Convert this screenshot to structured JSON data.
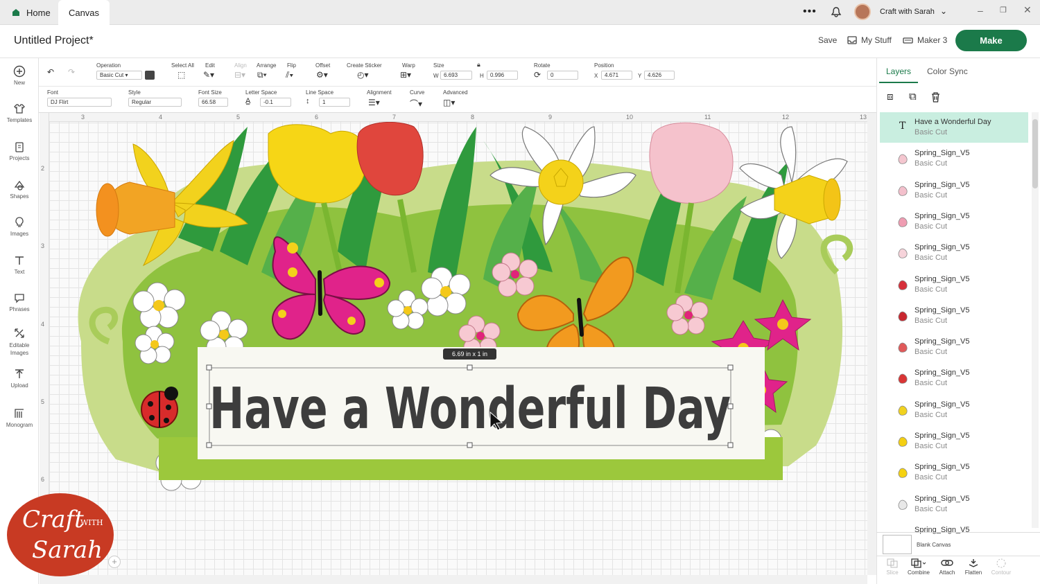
{
  "top_tabs": {
    "home": "Home",
    "canvas": "Canvas"
  },
  "account": {
    "name": "Craft with Sarah"
  },
  "project": {
    "title": "Untitled Project*",
    "save": "Save",
    "my_stuff": "My Stuff",
    "machine": "Maker 3",
    "make": "Make"
  },
  "left_nav": [
    {
      "label": "New",
      "icon": "plus-circle-icon"
    },
    {
      "label": "Templates",
      "icon": "shirt-icon"
    },
    {
      "label": "Projects",
      "icon": "clipboard-icon"
    },
    {
      "label": "Shapes",
      "icon": "shapes-icon"
    },
    {
      "label": "Images",
      "icon": "bulb-icon"
    },
    {
      "label": "Text",
      "icon": "text-icon"
    },
    {
      "label": "Phrases",
      "icon": "speech-icon"
    },
    {
      "label": "Editable Images",
      "icon": "edit-image-icon"
    },
    {
      "label": "Upload",
      "icon": "upload-icon"
    },
    {
      "label": "Monogram",
      "icon": "monogram-icon"
    }
  ],
  "toolbar1": {
    "operation_label": "Operation",
    "operation_value": "Basic Cut",
    "select_all": "Select All",
    "edit": "Edit",
    "align": "Align",
    "arrange": "Arrange",
    "flip": "Flip",
    "offset": "Offset",
    "create_sticker": "Create Sticker",
    "warp": "Warp",
    "size_label": "Size",
    "w_label": "W",
    "w_value": "6.693",
    "h_label": "H",
    "h_value": "0.996",
    "rotate_label": "Rotate",
    "rotate_value": "0",
    "position_label": "Position",
    "x_label": "X",
    "x_value": "4.671",
    "y_label": "Y",
    "y_value": "4.626"
  },
  "toolbar2": {
    "font_label": "Font",
    "font_value": "DJ Flirt",
    "style_label": "Style",
    "style_value": "Regular",
    "font_size_label": "Font Size",
    "font_size_value": "66.58",
    "letter_space_label": "Letter Space",
    "letter_space_value": "-0.1",
    "line_space_label": "Line Space",
    "line_space_value": "1",
    "alignment_label": "Alignment",
    "curve_label": "Curve",
    "advanced_label": "Advanced"
  },
  "ruler_h": [
    "3",
    "4",
    "5",
    "6",
    "7",
    "8",
    "9",
    "10",
    "11",
    "12",
    "13"
  ],
  "ruler_v": [
    "2",
    "3",
    "4",
    "5",
    "6"
  ],
  "canvas": {
    "text": "Have a Wonderful Day",
    "size_tooltip": "6.69  in x 1  in"
  },
  "panel": {
    "tab_layers": "Layers",
    "tab_color_sync": "Color Sync",
    "layers": [
      {
        "name": "Have a Wonderful Day",
        "op": "Basic Cut",
        "color": "#444444"
      },
      {
        "name": "Spring_Sign_V5",
        "op": "Basic Cut",
        "color": "#f4c6cf"
      },
      {
        "name": "Spring_Sign_V5",
        "op": "Basic Cut",
        "color": "#f3c0cc"
      },
      {
        "name": "Spring_Sign_V5",
        "op": "Basic Cut",
        "color": "#ef9db2"
      },
      {
        "name": "Spring_Sign_V5",
        "op": "Basic Cut",
        "color": "#f6d3da"
      },
      {
        "name": "Spring_Sign_V5",
        "op": "Basic Cut",
        "color": "#d62f3a"
      },
      {
        "name": "Spring_Sign_V5",
        "op": "Basic Cut",
        "color": "#c8262f"
      },
      {
        "name": "Spring_Sign_V5",
        "op": "Basic Cut",
        "color": "#e0595a"
      },
      {
        "name": "Spring_Sign_V5",
        "op": "Basic Cut",
        "color": "#d93535"
      },
      {
        "name": "Spring_Sign_V5",
        "op": "Basic Cut",
        "color": "#f1d21f"
      },
      {
        "name": "Spring_Sign_V5",
        "op": "Basic Cut",
        "color": "#f4cf12"
      },
      {
        "name": "Spring_Sign_V5",
        "op": "Basic Cut",
        "color": "#f5d211"
      },
      {
        "name": "Spring_Sign_V5",
        "op": "Basic Cut",
        "color": "#e8e8e8"
      },
      {
        "name": "Spring_Sign_V5",
        "op": ""
      }
    ],
    "blank_canvas": "Blank Canvas",
    "bottom": {
      "slice": "Slice",
      "combine": "Combine",
      "attach": "Attach",
      "flatten": "Flatten",
      "contour": "Contour"
    }
  },
  "logo": {
    "line1": "Craft",
    "with": "WITH",
    "line2": "Sarah"
  },
  "colors": {
    "brand": "#1b7a4a",
    "accent_teal": "#c9eee0",
    "sign_green": "#9cc83c",
    "dark_green": "#2e8b3a"
  }
}
